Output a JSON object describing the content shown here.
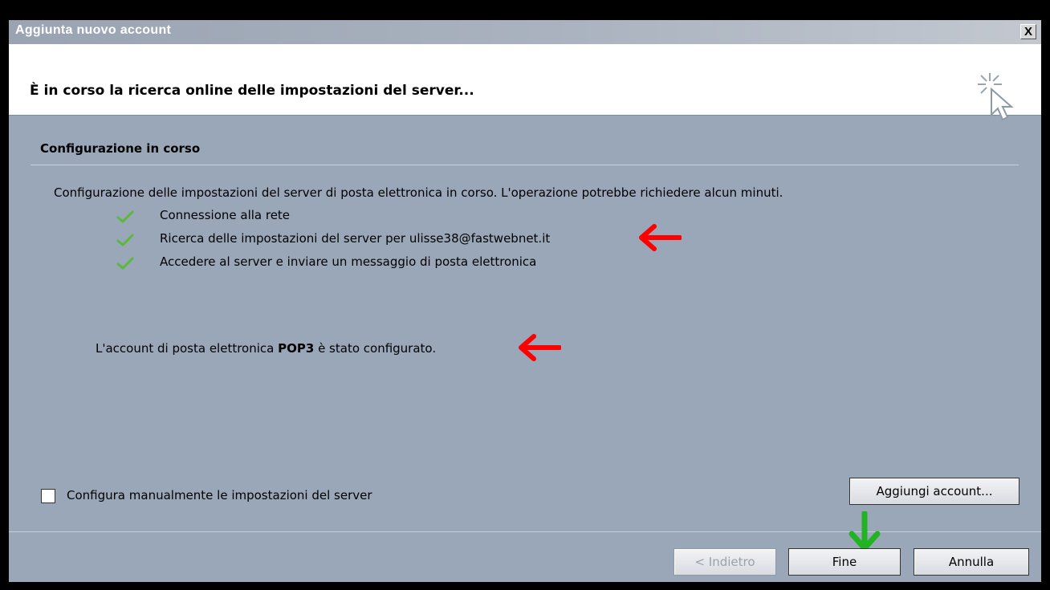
{
  "window": {
    "title": "Aggiunta nuovo account",
    "close_label": "X"
  },
  "header": {
    "title": "È in corso la ricerca online delle impostazioni del server..."
  },
  "section": {
    "title": "Configurazione in corso",
    "description": "Configurazione delle impostazioni del server di posta elettronica in corso. L'operazione potrebbe richiedere alcun minuti."
  },
  "steps": [
    {
      "label": "Connessione alla rete",
      "icon": "checkmark-icon"
    },
    {
      "label": "Ricerca delle impostazioni del server per ulisse38@fastwebnet.it",
      "icon": "checkmark-icon"
    },
    {
      "label": "Accedere al server e inviare un messaggio di posta elettronica",
      "icon": "checkmark-icon"
    }
  ],
  "status": {
    "prefix": "L'account di posta elettronica ",
    "bold": "POP3",
    "suffix": " è stato configurato."
  },
  "manual_config": {
    "label": "Configura manualmente le impostazioni del server",
    "checked": false
  },
  "buttons": {
    "add_account": "Aggiungi account...",
    "back": "< Indietro",
    "finish": "Fine",
    "cancel": "Annulla"
  },
  "colors": {
    "annotation_red": "#ff0000",
    "annotation_green": "#22b322",
    "dialog_bg": "#9aa7b9"
  }
}
